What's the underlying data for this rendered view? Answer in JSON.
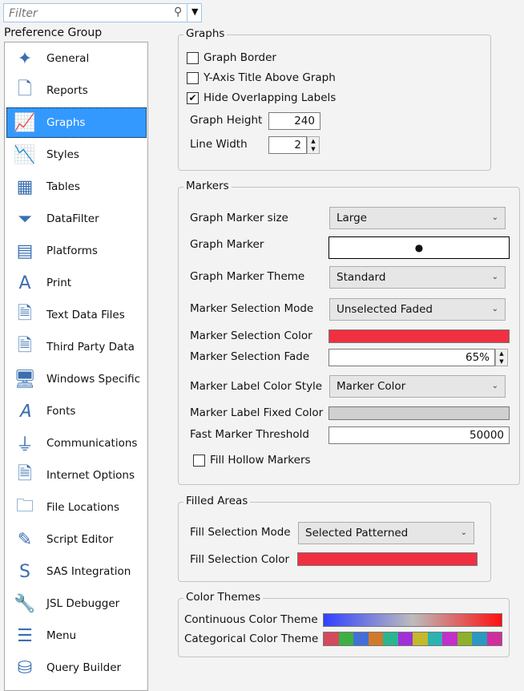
{
  "filter": {
    "placeholder": "Filter"
  },
  "sidebar": {
    "title": "Preference Group",
    "items": [
      {
        "label": "General",
        "icon": "general-icon"
      },
      {
        "label": "Reports",
        "icon": "reports-icon"
      },
      {
        "label": "Graphs",
        "icon": "graphs-icon",
        "selected": true
      },
      {
        "label": "Styles",
        "icon": "styles-icon"
      },
      {
        "label": "Tables",
        "icon": "tables-icon"
      },
      {
        "label": "DataFilter",
        "icon": "funnel-icon"
      },
      {
        "label": "Platforms",
        "icon": "platforms-icon"
      },
      {
        "label": "Print",
        "icon": "print-icon"
      },
      {
        "label": "Text Data Files",
        "icon": "txt-file-icon"
      },
      {
        "label": "Third Party Data",
        "icon": "txt-file-icon"
      },
      {
        "label": "Windows Specific",
        "icon": "monitor-icon"
      },
      {
        "label": "Fonts",
        "icon": "font-icon"
      },
      {
        "label": "Communications",
        "icon": "plug-icon"
      },
      {
        "label": "Internet Options",
        "icon": "txt-file-icon"
      },
      {
        "label": "File Locations",
        "icon": "folder-icon"
      },
      {
        "label": "Script Editor",
        "icon": "script-icon"
      },
      {
        "label": "SAS Integration",
        "icon": "sas-icon"
      },
      {
        "label": "JSL Debugger",
        "icon": "wrench-icon"
      },
      {
        "label": "Menu",
        "icon": "menu-icon"
      },
      {
        "label": "Query Builder",
        "icon": "database-icon"
      }
    ]
  },
  "graphs": {
    "title": "Graphs",
    "graph_border": "Graph Border",
    "y_axis_title": "Y-Axis Title Above Graph",
    "hide_overlapping": "Hide Overlapping Labels",
    "graph_height_label": "Graph Height",
    "graph_height": "240",
    "line_width_label": "Line Width",
    "line_width": "2"
  },
  "markers": {
    "title": "Markers",
    "size_label": "Graph Marker size",
    "size": "Large",
    "marker_label": "Graph Marker",
    "marker": "●",
    "theme_label": "Graph Marker Theme",
    "theme": "Standard",
    "sel_mode_label": "Marker Selection Mode",
    "sel_mode": "Unselected Faded",
    "sel_color_label": "Marker Selection Color",
    "sel_color": "#f03040",
    "fade_label": "Marker Selection Fade",
    "fade": "65%",
    "label_style_label": "Marker Label Color Style",
    "label_style": "Marker Color",
    "fixed_color_label": "Marker Label Fixed Color",
    "fixed_color": "#d0d0d0",
    "threshold_label": "Fast Marker Threshold",
    "threshold": "50000",
    "fill_hollow": "Fill Hollow Markers"
  },
  "filled": {
    "title": "Filled Areas",
    "mode_label": "Fill Selection Mode",
    "mode": "Selected Patterned",
    "color_label": "Fill Selection Color",
    "color": "#f03040"
  },
  "themes": {
    "title": "Color Themes",
    "continuous_label": "Continuous Color Theme",
    "categorical_label": "Categorical Color Theme",
    "categorical_colors": [
      "#d34a5c",
      "#3cb043",
      "#4270d8",
      "#d07a2a",
      "#2bb58e",
      "#a030d8",
      "#c4b92a",
      "#2cb2b0",
      "#c42ecc",
      "#8fb02a",
      "#2a98c0",
      "#d02e9c"
    ]
  }
}
